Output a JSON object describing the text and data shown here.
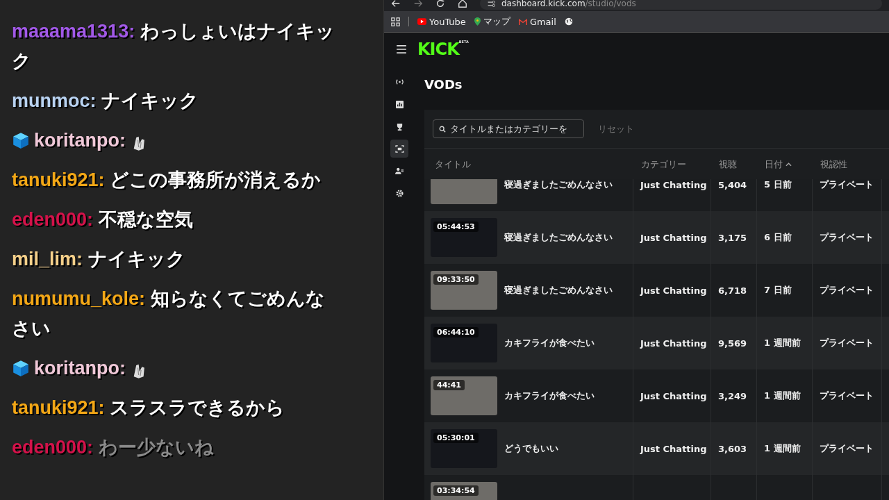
{
  "chat": {
    "messages": [
      {
        "user": "maaama1313:",
        "color": "#a259e8",
        "badge": false,
        "emote": false,
        "faded": false,
        "text": "わっしょいはナイキック"
      },
      {
        "user": "munmoc:",
        "color": "#b9d3f2",
        "badge": false,
        "emote": false,
        "faded": false,
        "text": "ナイキック"
      },
      {
        "user": "koritanpo:",
        "color": "#f0c8d8",
        "badge": true,
        "emote": true,
        "faded": false
      },
      {
        "user": "tanuki921:",
        "color": "#f3a716",
        "badge": false,
        "emote": false,
        "faded": false,
        "text": "どこの事務所が消えるか"
      },
      {
        "user": "eden000:",
        "color": "#d4124a",
        "badge": false,
        "emote": false,
        "faded": false,
        "text": "不穏な空気"
      },
      {
        "user": "mil_lim:",
        "color": "#f5d08a",
        "badge": false,
        "emote": false,
        "faded": false,
        "text": "ナイキック"
      },
      {
        "user": "numumu_kole:",
        "color": "#f3a716",
        "badge": false,
        "emote": false,
        "faded": false,
        "text": "知らなくてごめんなさい"
      },
      {
        "user": "koritanpo:",
        "color": "#f0c8d8",
        "badge": true,
        "emote": true,
        "faded": false
      },
      {
        "user": "tanuki921:",
        "color": "#f3a716",
        "badge": false,
        "emote": false,
        "faded": false,
        "text": "スラスラできるから"
      },
      {
        "user": "eden000:",
        "color": "#d4124a",
        "badge": false,
        "emote": false,
        "faded": true,
        "text": "わー少ないね"
      }
    ]
  },
  "browser": {
    "url_host": "dashboard.kick.com",
    "url_path": "/studio/vods",
    "bookmarks": [
      {
        "kind": "youtube",
        "label": "YouTube"
      },
      {
        "kind": "maps",
        "label": "マップ"
      },
      {
        "kind": "gmail",
        "label": "Gmail"
      },
      {
        "kind": "globe"
      }
    ]
  },
  "app": {
    "logo": "KICK",
    "logo_tag": "BETA",
    "rail": [
      {
        "kind": "live",
        "selected": false
      },
      {
        "kind": "chart",
        "selected": false
      },
      {
        "kind": "trophy",
        "selected": false
      },
      {
        "kind": "vod",
        "selected": true
      },
      {
        "kind": "users",
        "selected": false
      },
      {
        "kind": "settings",
        "selected": false
      }
    ],
    "page_title": "VODs",
    "search": {
      "placeholder": "タイトルまたはカテゴリーを"
    },
    "reset": "リセット",
    "table": {
      "columns": [
        {
          "label": "タイトル",
          "sorted": false
        },
        {
          "label": "カテゴリー",
          "sorted": false
        },
        {
          "label": "視聴",
          "sorted": false
        },
        {
          "label": "日付",
          "sorted": true
        },
        {
          "label": "視認性",
          "sorted": false
        }
      ],
      "rows": [
        {
          "title": "寝過ぎましたごめんなさい",
          "category": "Just Chatting",
          "views": "5,404",
          "date": "5 日前",
          "visibility": "プライベート"
        },
        {
          "duration": "05:44:53",
          "title": "寝過ぎましたごめんなさい",
          "category": "Just Chatting",
          "views": "3,175",
          "date": "6 日前",
          "visibility": "プライベート"
        },
        {
          "duration": "09:33:50",
          "title": "寝過ぎましたごめんなさい",
          "category": "Just Chatting",
          "views": "6,718",
          "date": "7 日前",
          "visibility": "プライベート"
        },
        {
          "duration": "06:44:10",
          "title": "カキフライが食べたい",
          "category": "Just Chatting",
          "views": "9,569",
          "date": "1 週間前",
          "visibility": "プライベート"
        },
        {
          "duration": "44:41",
          "title": "カキフライが食べたい",
          "category": "Just Chatting",
          "views": "3,249",
          "date": "1 週間前",
          "visibility": "プライベート"
        },
        {
          "duration": "05:30:01",
          "title": "どうでもいい",
          "category": "Just Chatting",
          "views": "3,603",
          "date": "1 週間前",
          "visibility": "プライベート"
        },
        {
          "duration": "03:34:54"
        }
      ]
    }
  }
}
